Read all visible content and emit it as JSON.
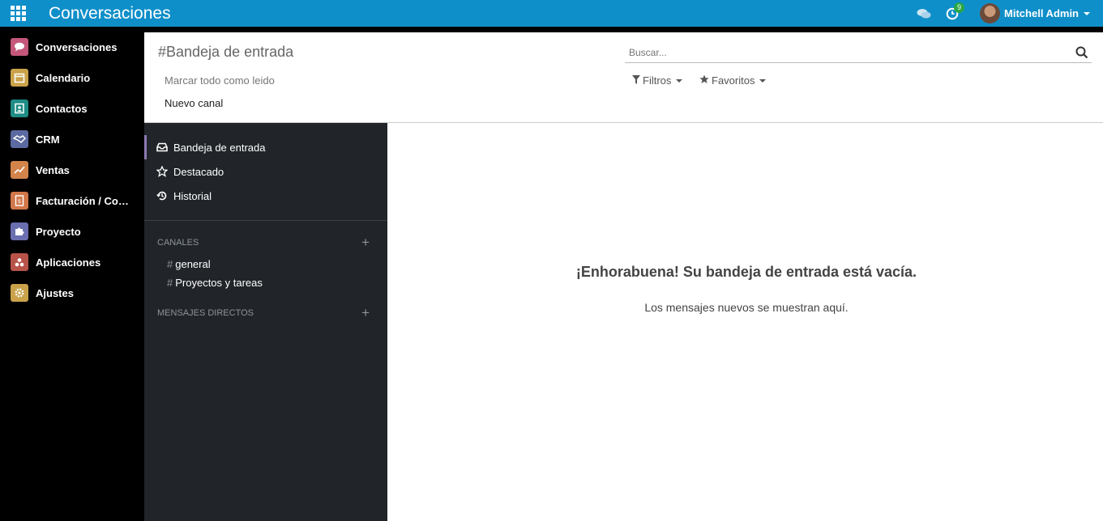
{
  "topbar": {
    "title": "Conversaciones",
    "activity_count": "9",
    "user_name": "Mitchell Admin"
  },
  "apps": [
    {
      "label": "Conversaciones",
      "icon": "chat-bubble-icon",
      "color": "#c4577a"
    },
    {
      "label": "Calendario",
      "icon": "calendar-icon",
      "color": "#c9a24a"
    },
    {
      "label": "Contactos",
      "icon": "address-book-icon",
      "color": "#1f8c86"
    },
    {
      "label": "CRM",
      "icon": "handshake-icon",
      "color": "#5b6aa0"
    },
    {
      "label": "Ventas",
      "icon": "chart-line-icon",
      "color": "#d3844a"
    },
    {
      "label": "Facturación / Contabilidad",
      "icon": "invoice-icon",
      "color": "#d1774a"
    },
    {
      "label": "Proyecto",
      "icon": "puzzle-icon",
      "color": "#6a6fb0"
    },
    {
      "label": "Aplicaciones",
      "icon": "cubes-icon",
      "color": "#b8534a"
    },
    {
      "label": "Ajustes",
      "icon": "gear-icon",
      "color": "#c9a24a"
    }
  ],
  "control_panel": {
    "title": "#Bandeja de entrada",
    "mark_all_read": "Marcar todo como leido",
    "new_channel": "Nuevo canal",
    "search_placeholder": "Buscar...",
    "filters_label": "Filtros",
    "favorites_label": "Favoritos"
  },
  "mailboxes": [
    {
      "label": "Bandeja de entrada",
      "icon": "inbox-icon",
      "active": true
    },
    {
      "label": "Destacado",
      "icon": "star-outline-icon",
      "active": false
    },
    {
      "label": "Historial",
      "icon": "history-icon",
      "active": false
    }
  ],
  "channels_header": "CANALES",
  "channels": [
    "general",
    "Proyectos y tareas"
  ],
  "direct_messages_header": "MENSAJES DIRECTOS",
  "empty_state": {
    "title": "¡Enhorabuena! Su bandeja de entrada está vacía.",
    "subtitle": "Los mensajes nuevos se muestran aquí."
  },
  "colors": {
    "topbar": "#0f8fc9",
    "sidebar": "#000000",
    "discuss_sidebar": "#212529",
    "active_marker": "#8c7ab2",
    "badge": "#28a745"
  }
}
